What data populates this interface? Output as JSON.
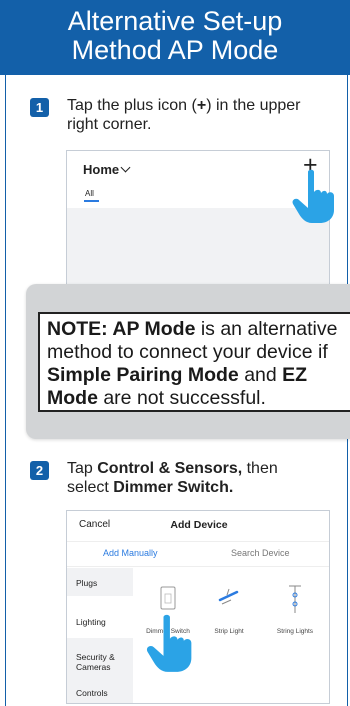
{
  "header": {
    "title_line1": "Alternative Set-up",
    "title_line2": "Method AP Mode"
  },
  "step1": {
    "number": "1",
    "text_pre": "Tap the plus icon (",
    "text_plus": "+",
    "text_post": ") in the upper",
    "text_line2": "right corner.",
    "screen": {
      "home_label": "Home",
      "plus_label": "+",
      "tab_all": "All"
    }
  },
  "note": {
    "b1": "NOTE: AP Mode",
    "t1": " is an alternative",
    "t2": "method to connect your device if",
    "b2": "Simple Pairing Mode",
    "t3": " and ",
    "b3": "EZ",
    "b4": "Mode",
    "t4": " are not successful."
  },
  "step2": {
    "number": "2",
    "text_pre": "Tap ",
    "text_b1": "Control & Sensors,",
    "text_post": " then",
    "text_line2_pre": "select ",
    "text_b2": "Dimmer Switch.",
    "screen": {
      "cancel": "Cancel",
      "title": "Add Device",
      "tab_manual": "Add Manually",
      "tab_search": "Search Device",
      "categories": [
        "Plugs",
        "Lighting",
        "Security & Cameras",
        "Controls"
      ],
      "devices": [
        "Dimmer Switch",
        "Strip Light",
        "String Lights"
      ]
    }
  },
  "colors": {
    "brand_blue": "#1360a9",
    "accent_blue": "#2b7be0",
    "note_gray": "#d2d4d6"
  }
}
